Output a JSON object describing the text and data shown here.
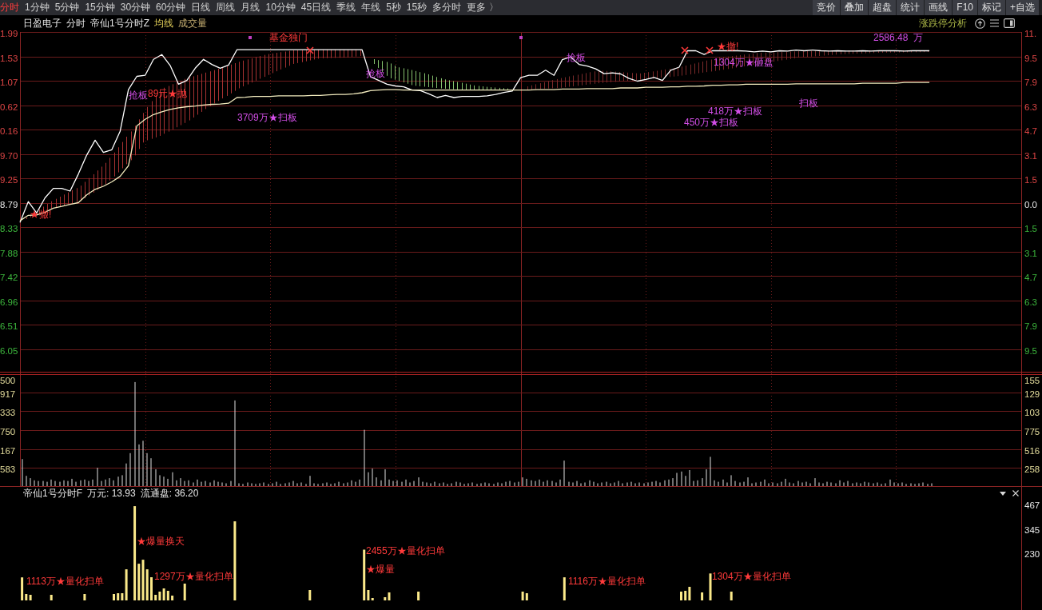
{
  "toolbar": {
    "tabs": [
      {
        "label": "分时",
        "selected": true
      },
      {
        "label": "1分钟",
        "selected": false
      },
      {
        "label": "5分钟",
        "selected": false
      },
      {
        "label": "15分钟",
        "selected": false
      },
      {
        "label": "30分钟",
        "selected": false
      },
      {
        "label": "60分钟",
        "selected": false
      },
      {
        "label": "日线",
        "selected": false
      },
      {
        "label": "周线",
        "selected": false
      },
      {
        "label": "月线",
        "selected": false
      },
      {
        "label": "10分钟",
        "selected": false
      },
      {
        "label": "45日线",
        "selected": false
      },
      {
        "label": "季线",
        "selected": false
      },
      {
        "label": "年线",
        "selected": false
      },
      {
        "label": "5秒",
        "selected": false
      },
      {
        "label": "15秒",
        "selected": false
      },
      {
        "label": "多分时",
        "selected": false
      },
      {
        "label": "更多 〉",
        "selected": false
      }
    ],
    "buttons": [
      "竞价",
      "叠加",
      "超盘",
      "统计",
      "画线",
      "F10",
      "标记",
      "+自选"
    ]
  },
  "chart_header": {
    "items": [
      "日盈电子",
      "分时",
      "帝仙1号分时Z",
      "均线",
      "成交量"
    ],
    "link": "涨跌停分析"
  },
  "price_chart": {
    "axis_rows": [
      {
        "price": "1.99",
        "percent": "11.",
        "kind": "up"
      },
      {
        "price": "1.53",
        "percent": "9.5",
        "kind": "up"
      },
      {
        "price": "1.07",
        "percent": "7.9",
        "kind": "up"
      },
      {
        "price": "0.62",
        "percent": "6.3",
        "kind": "up"
      },
      {
        "price": "0.16",
        "percent": "4.7",
        "kind": "up"
      },
      {
        "price": "9.70",
        "percent": "3.1",
        "kind": "up"
      },
      {
        "price": "9.25",
        "percent": "1.5",
        "kind": "up"
      },
      {
        "price": "8.79",
        "percent": "0.0",
        "kind": "flat"
      },
      {
        "price": "8.33",
        "percent": "1.5",
        "kind": "down"
      },
      {
        "price": "7.88",
        "percent": "3.1",
        "kind": "down"
      },
      {
        "price": "7.42",
        "percent": "4.7",
        "kind": "down"
      },
      {
        "price": "6.96",
        "percent": "6.3",
        "kind": "down"
      },
      {
        "price": "6.51",
        "percent": "7.9",
        "kind": "down"
      },
      {
        "price": "6.05",
        "percent": "9.5",
        "kind": "down"
      }
    ],
    "signals": [
      {
        "text": "★撤!",
        "kind": "red"
      },
      {
        "text": "抢板",
        "kind": "magenta"
      },
      {
        "text": "89元★抛",
        "kind": "red"
      },
      {
        "text": "基金独门",
        "kind": "red"
      },
      {
        "text": "3709万★扫板",
        "kind": "magenta"
      },
      {
        "text": "抢板",
        "kind": "magenta"
      },
      {
        "text": "抢板",
        "kind": "magenta"
      },
      {
        "text": "★撤!",
        "kind": "red"
      },
      {
        "text": "1304万★砸盘",
        "kind": "magenta"
      },
      {
        "text": "2586.48  万",
        "kind": "magenta"
      },
      {
        "text": "450万★扫板",
        "kind": "magenta"
      },
      {
        "text": "418万★扫板",
        "kind": "magenta"
      },
      {
        "text": "扫板",
        "kind": "magenta"
      }
    ]
  },
  "volume_chart": {
    "left_labels": [
      "500",
      "917",
      "333",
      "750",
      "167",
      "583"
    ],
    "right_labels": [
      "155",
      "129",
      "103",
      "775",
      "516",
      "258"
    ]
  },
  "indicator_panel": {
    "title": "帝仙1号分时F",
    "fields": [
      "万元: 13.93",
      "流通盘: 36.20"
    ],
    "axis_labels": [
      "467",
      "345",
      "230"
    ],
    "signals": [
      "1113万★量化扫单",
      "★爆量换天",
      "1297万★量化扫单",
      "2455万★量化扫单",
      "★爆量",
      "1116万★量化扫单",
      "1304万★量化扫单"
    ]
  }
}
